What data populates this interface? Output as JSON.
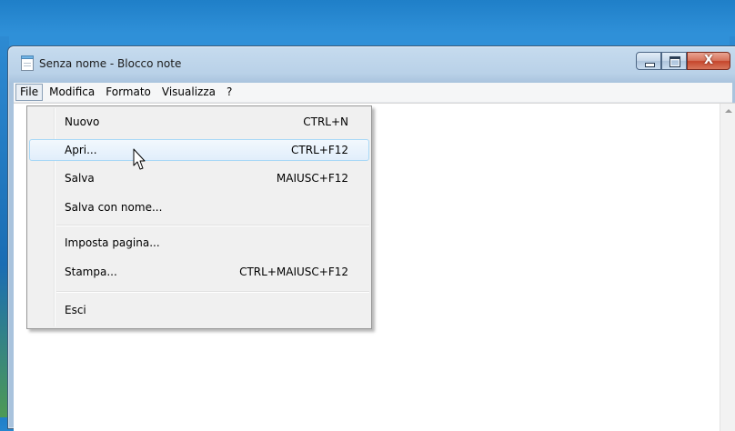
{
  "window": {
    "title": "Senza nome - Blocco note",
    "caption_buttons": {
      "minimize": "minimize-icon",
      "maximize": "maximize-icon",
      "close": "close-icon"
    },
    "close_glyph": "X"
  },
  "menubar": {
    "items": [
      {
        "label": "File",
        "active": true
      },
      {
        "label": "Modifica"
      },
      {
        "label": "Formato"
      },
      {
        "label": "Visualizza"
      },
      {
        "label": "?"
      }
    ]
  },
  "file_menu": {
    "items": [
      {
        "label": "Nuovo",
        "shortcut": "CTRL+N"
      },
      {
        "label": "Apri...",
        "shortcut": "CTRL+F12",
        "highlighted": true
      },
      {
        "label": "Salva",
        "shortcut": "MAIUSC+F12"
      },
      {
        "label": "Salva con nome...",
        "shortcut": ""
      },
      {
        "label": "Imposta pagina...",
        "shortcut": ""
      },
      {
        "label": "Stampa...",
        "shortcut": "CTRL+MAIUSC+F12"
      },
      {
        "label": "Esci",
        "shortcut": ""
      }
    ]
  },
  "colors": {
    "desktop": "#2f90d8",
    "frame": "#b9d1e8",
    "close_button": "#c5462c",
    "menu_background": "#f0f0f0",
    "hover_border": "#a8d8f6"
  }
}
